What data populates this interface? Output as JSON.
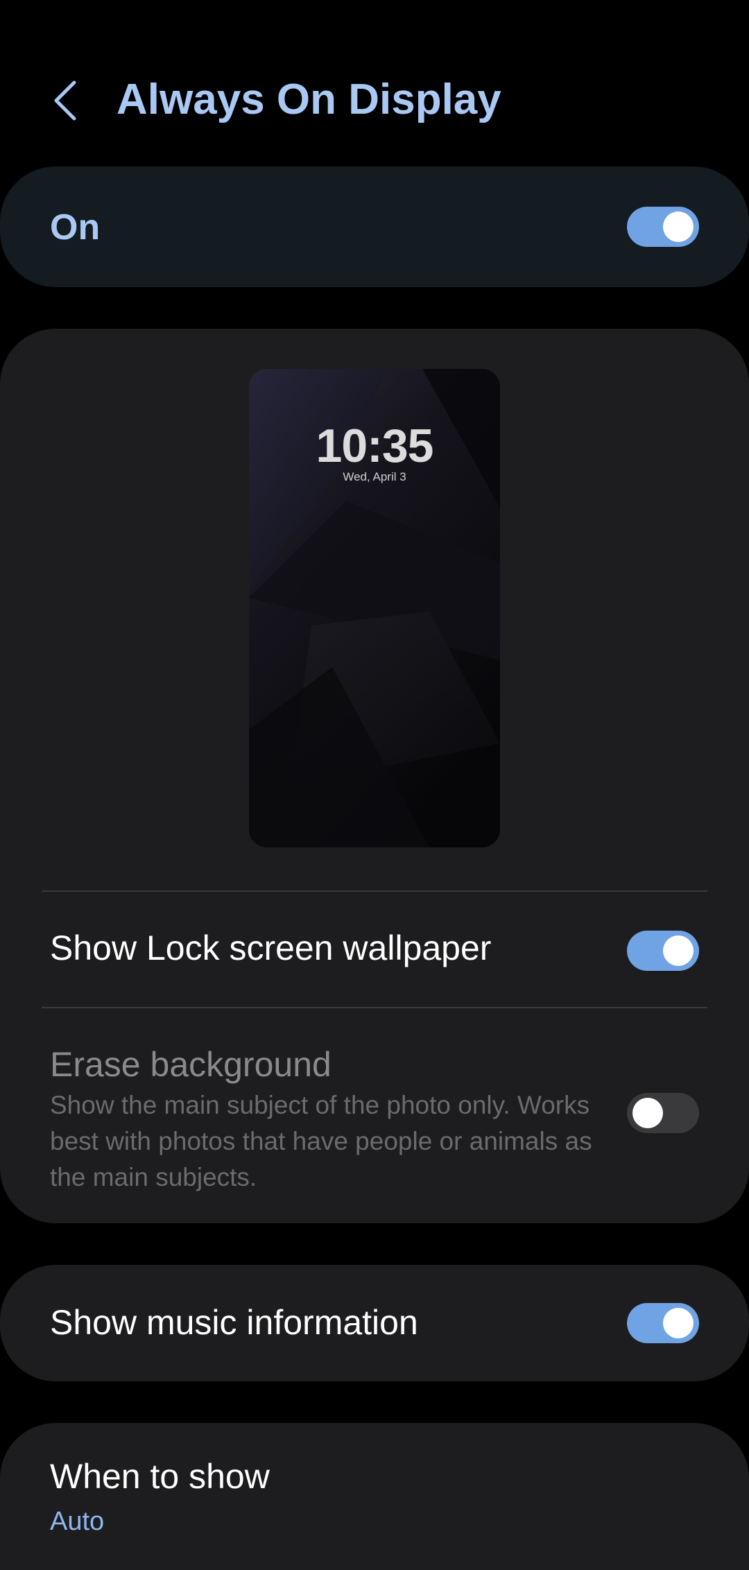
{
  "header": {
    "title": "Always On Display"
  },
  "master": {
    "label": "On",
    "enabled": true
  },
  "preview": {
    "time": "10:35",
    "date": "Wed, April 3"
  },
  "settings": {
    "lock_wallpaper": {
      "label": "Show Lock screen wallpaper",
      "enabled": true
    },
    "erase_background": {
      "label": "Erase background",
      "description": "Show the main subject of the photo only. Works best with photos that have people or animals as the main subjects.",
      "enabled": false
    },
    "music_info": {
      "label": "Show music information",
      "enabled": true
    },
    "when_to_show": {
      "label": "When to show",
      "value": "Auto"
    }
  },
  "colors": {
    "accent": "#a9c8f3",
    "toggle_on": "#6fa3e3",
    "toggle_off": "#3a3a3c",
    "card_bg": "#1d1d1f",
    "master_card_bg": "#141b21"
  },
  "icons": {
    "back": "chevron-left-icon"
  }
}
